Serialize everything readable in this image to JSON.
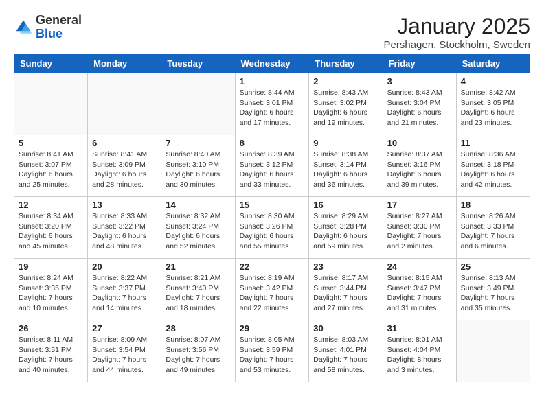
{
  "logo": {
    "general": "General",
    "blue": "Blue"
  },
  "title": "January 2025",
  "location": "Pershagen, Stockholm, Sweden",
  "days_of_week": [
    "Sunday",
    "Monday",
    "Tuesday",
    "Wednesday",
    "Thursday",
    "Friday",
    "Saturday"
  ],
  "weeks": [
    [
      {
        "day": "",
        "info": ""
      },
      {
        "day": "",
        "info": ""
      },
      {
        "day": "",
        "info": ""
      },
      {
        "day": "1",
        "info": "Sunrise: 8:44 AM\nSunset: 3:01 PM\nDaylight: 6 hours\nand 17 minutes."
      },
      {
        "day": "2",
        "info": "Sunrise: 8:43 AM\nSunset: 3:02 PM\nDaylight: 6 hours\nand 19 minutes."
      },
      {
        "day": "3",
        "info": "Sunrise: 8:43 AM\nSunset: 3:04 PM\nDaylight: 6 hours\nand 21 minutes."
      },
      {
        "day": "4",
        "info": "Sunrise: 8:42 AM\nSunset: 3:05 PM\nDaylight: 6 hours\nand 23 minutes."
      }
    ],
    [
      {
        "day": "5",
        "info": "Sunrise: 8:41 AM\nSunset: 3:07 PM\nDaylight: 6 hours\nand 25 minutes."
      },
      {
        "day": "6",
        "info": "Sunrise: 8:41 AM\nSunset: 3:09 PM\nDaylight: 6 hours\nand 28 minutes."
      },
      {
        "day": "7",
        "info": "Sunrise: 8:40 AM\nSunset: 3:10 PM\nDaylight: 6 hours\nand 30 minutes."
      },
      {
        "day": "8",
        "info": "Sunrise: 8:39 AM\nSunset: 3:12 PM\nDaylight: 6 hours\nand 33 minutes."
      },
      {
        "day": "9",
        "info": "Sunrise: 8:38 AM\nSunset: 3:14 PM\nDaylight: 6 hours\nand 36 minutes."
      },
      {
        "day": "10",
        "info": "Sunrise: 8:37 AM\nSunset: 3:16 PM\nDaylight: 6 hours\nand 39 minutes."
      },
      {
        "day": "11",
        "info": "Sunrise: 8:36 AM\nSunset: 3:18 PM\nDaylight: 6 hours\nand 42 minutes."
      }
    ],
    [
      {
        "day": "12",
        "info": "Sunrise: 8:34 AM\nSunset: 3:20 PM\nDaylight: 6 hours\nand 45 minutes."
      },
      {
        "day": "13",
        "info": "Sunrise: 8:33 AM\nSunset: 3:22 PM\nDaylight: 6 hours\nand 48 minutes."
      },
      {
        "day": "14",
        "info": "Sunrise: 8:32 AM\nSunset: 3:24 PM\nDaylight: 6 hours\nand 52 minutes."
      },
      {
        "day": "15",
        "info": "Sunrise: 8:30 AM\nSunset: 3:26 PM\nDaylight: 6 hours\nand 55 minutes."
      },
      {
        "day": "16",
        "info": "Sunrise: 8:29 AM\nSunset: 3:28 PM\nDaylight: 6 hours\nand 59 minutes."
      },
      {
        "day": "17",
        "info": "Sunrise: 8:27 AM\nSunset: 3:30 PM\nDaylight: 7 hours\nand 2 minutes."
      },
      {
        "day": "18",
        "info": "Sunrise: 8:26 AM\nSunset: 3:33 PM\nDaylight: 7 hours\nand 6 minutes."
      }
    ],
    [
      {
        "day": "19",
        "info": "Sunrise: 8:24 AM\nSunset: 3:35 PM\nDaylight: 7 hours\nand 10 minutes."
      },
      {
        "day": "20",
        "info": "Sunrise: 8:22 AM\nSunset: 3:37 PM\nDaylight: 7 hours\nand 14 minutes."
      },
      {
        "day": "21",
        "info": "Sunrise: 8:21 AM\nSunset: 3:40 PM\nDaylight: 7 hours\nand 18 minutes."
      },
      {
        "day": "22",
        "info": "Sunrise: 8:19 AM\nSunset: 3:42 PM\nDaylight: 7 hours\nand 22 minutes."
      },
      {
        "day": "23",
        "info": "Sunrise: 8:17 AM\nSunset: 3:44 PM\nDaylight: 7 hours\nand 27 minutes."
      },
      {
        "day": "24",
        "info": "Sunrise: 8:15 AM\nSunset: 3:47 PM\nDaylight: 7 hours\nand 31 minutes."
      },
      {
        "day": "25",
        "info": "Sunrise: 8:13 AM\nSunset: 3:49 PM\nDaylight: 7 hours\nand 35 minutes."
      }
    ],
    [
      {
        "day": "26",
        "info": "Sunrise: 8:11 AM\nSunset: 3:51 PM\nDaylight: 7 hours\nand 40 minutes."
      },
      {
        "day": "27",
        "info": "Sunrise: 8:09 AM\nSunset: 3:54 PM\nDaylight: 7 hours\nand 44 minutes."
      },
      {
        "day": "28",
        "info": "Sunrise: 8:07 AM\nSunset: 3:56 PM\nDaylight: 7 hours\nand 49 minutes."
      },
      {
        "day": "29",
        "info": "Sunrise: 8:05 AM\nSunset: 3:59 PM\nDaylight: 7 hours\nand 53 minutes."
      },
      {
        "day": "30",
        "info": "Sunrise: 8:03 AM\nSunset: 4:01 PM\nDaylight: 7 hours\nand 58 minutes."
      },
      {
        "day": "31",
        "info": "Sunrise: 8:01 AM\nSunset: 4:04 PM\nDaylight: 8 hours\nand 3 minutes."
      },
      {
        "day": "",
        "info": ""
      }
    ]
  ]
}
